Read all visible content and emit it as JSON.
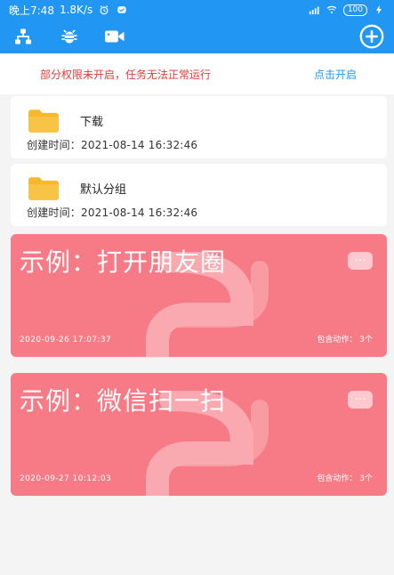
{
  "status_bar": {
    "time": "晚上7:48",
    "speed": "1.8K/s",
    "battery": "100"
  },
  "toolbar": {
    "icons": [
      "sitemap-icon",
      "bug-icon",
      "video-icon",
      "add-circle-icon"
    ]
  },
  "warning": {
    "text": "部分权限未开启，任务无法正常运行",
    "link": "点击开启"
  },
  "groups": [
    {
      "name": "下载",
      "time_label": "创建时间：",
      "time": "2021-08-14 16:32:46"
    },
    {
      "name": "默认分组",
      "time_label": "创建时间：",
      "time": "2021-08-14 16:32:46"
    }
  ],
  "examples": [
    {
      "title": "示例：打开朋友圈",
      "date": "2020-09-26 17:07:37",
      "actions": "包含动作：  3个",
      "more": "···"
    },
    {
      "title": "示例：微信扫一扫",
      "date": "2020-09-27 10:12:03",
      "actions": "包含动作：  3个",
      "more": "···"
    }
  ],
  "colors": {
    "primary": "#2196f3",
    "warning_text": "#e53935",
    "example_card": "#f77b86",
    "folder": "#f6b82c"
  }
}
